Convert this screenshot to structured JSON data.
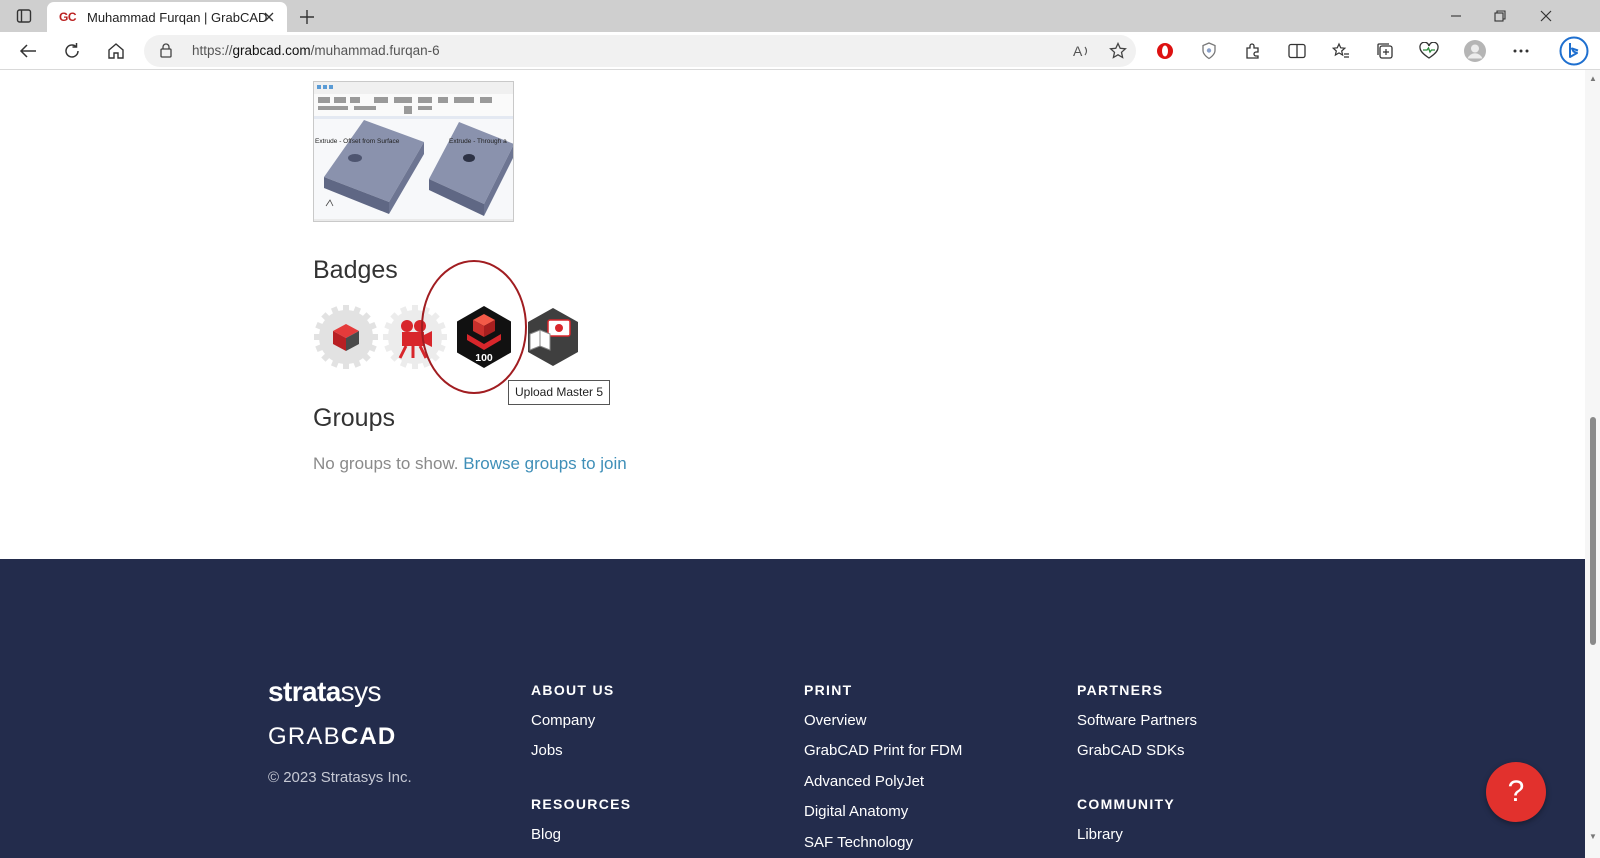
{
  "browser": {
    "tab": {
      "favicon_text": "GC",
      "title": "Muhammad Furqan | GrabCAD"
    },
    "address": {
      "url_prefix": "https://",
      "url_host": "grabcad.com",
      "url_path": "/muhammad.furqan-6"
    },
    "icons": [
      "sidebar-icon",
      "close-icon",
      "plus-icon",
      "minimize-icon",
      "restore-icon",
      "close-icon",
      "back-icon",
      "refresh-icon",
      "home-icon",
      "lock-icon",
      "read-aloud-icon",
      "star-icon",
      "opera-icon",
      "shield-icon",
      "extensions-icon",
      "split-screen-icon",
      "favorites-icon",
      "collections-icon",
      "performance-icon",
      "profile-avatar",
      "more-icon",
      "bing-icon"
    ]
  },
  "thumbnail": {
    "label_left": "Extrude - Offset from Surface",
    "label_right": "Extrude - Through a"
  },
  "badges": {
    "title": "Badges",
    "items": [
      {
        "name": "cube-badge"
      },
      {
        "name": "camera-badge"
      },
      {
        "name": "upload-master-badge",
        "number": "100"
      },
      {
        "name": "tutorial-badge"
      }
    ],
    "tooltip": "Upload Master 5"
  },
  "groups": {
    "title": "Groups",
    "empty_text": "No groups to show.",
    "browse_link": "Browse groups to join"
  },
  "footer": {
    "logo_stratasys_bold": "strata",
    "logo_stratasys_light": "sys",
    "logo_grabcad_light": "GRAB",
    "logo_grabcad_bold": "CAD",
    "copyright": "© 2023 Stratasys Inc.",
    "about": {
      "heading": "ABOUT US",
      "links": [
        "Company",
        "Jobs"
      ]
    },
    "resources": {
      "heading": "RESOURCES",
      "links": [
        "Blog"
      ]
    },
    "print": {
      "heading": "PRINT",
      "links": [
        "Overview",
        "GrabCAD Print for FDM",
        "Advanced PolyJet",
        "Digital Anatomy",
        "SAF Technology"
      ]
    },
    "partners": {
      "heading": "PARTNERS",
      "links": [
        "Software Partners",
        "GrabCAD SDKs"
      ]
    },
    "community": {
      "heading": "COMMUNITY",
      "links": [
        "Library"
      ]
    }
  },
  "help_button": {
    "label": "?"
  },
  "colors": {
    "footer_bg": "#232c4c",
    "link": "#3f8fb8",
    "help": "#e2312d",
    "highlight": "#a11d21"
  }
}
